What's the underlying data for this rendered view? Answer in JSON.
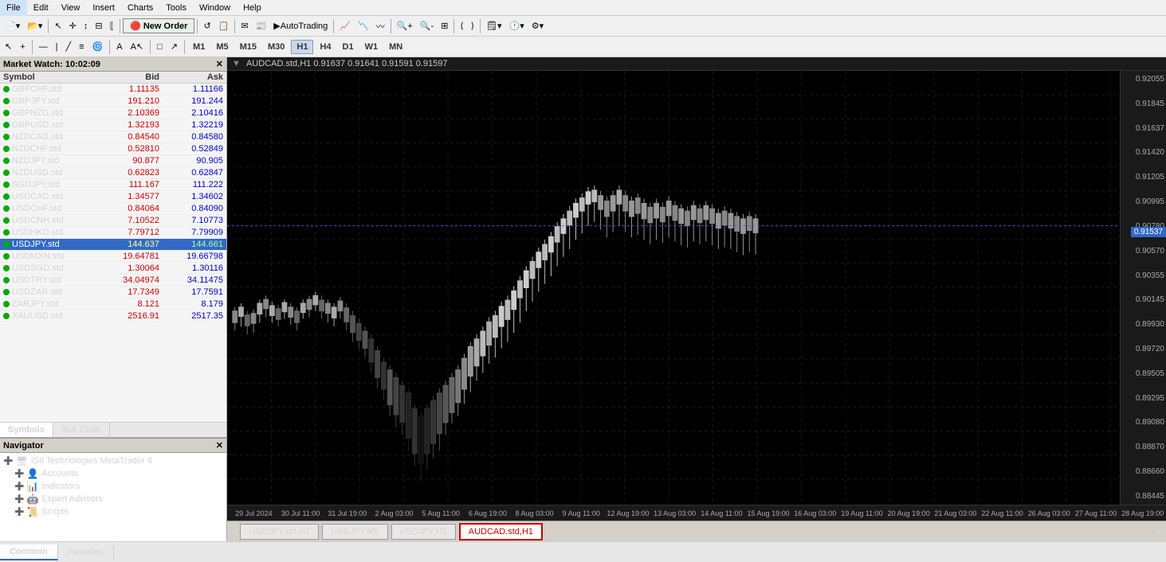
{
  "app": {
    "title": "IS6 Technologies MetaTrader 4"
  },
  "menu": {
    "items": [
      "File",
      "Edit",
      "View",
      "Insert",
      "Charts",
      "Tools",
      "Window",
      "Help"
    ]
  },
  "toolbar1": {
    "new_order_label": "New Order",
    "autotrading_label": "AutoTrading"
  },
  "timeframes": {
    "buttons": [
      "M1",
      "M5",
      "M15",
      "M30",
      "H1",
      "H4",
      "D1",
      "W1",
      "MN"
    ]
  },
  "market_watch": {
    "title": "Market Watch: 10:02:09",
    "columns": [
      "Symbol",
      "Bid",
      "Ask"
    ],
    "symbols": [
      {
        "name": "GBPCHF.std",
        "bid": "1.11135",
        "ask": "1.11166",
        "dot": "green"
      },
      {
        "name": "GBPJPY.std",
        "bid": "191.210",
        "ask": "191.244",
        "dot": "green"
      },
      {
        "name": "GBPNZD.std",
        "bid": "2.10369",
        "ask": "2.10416",
        "dot": "green"
      },
      {
        "name": "GBPUSD.std",
        "bid": "1.32193",
        "ask": "1.32219",
        "dot": "green"
      },
      {
        "name": "NZDCAD.std",
        "bid": "0.84540",
        "ask": "0.84580",
        "dot": "green"
      },
      {
        "name": "NZDCHF.std",
        "bid": "0.52810",
        "ask": "0.52849",
        "dot": "green"
      },
      {
        "name": "NZDJPY.std",
        "bid": "90.877",
        "ask": "90.905",
        "dot": "green"
      },
      {
        "name": "NZDUSD.std",
        "bid": "0.62823",
        "ask": "0.62847",
        "dot": "green"
      },
      {
        "name": "SGDJPY.std",
        "bid": "111.167",
        "ask": "111.222",
        "dot": "green"
      },
      {
        "name": "USDCAD.std",
        "bid": "1.34577",
        "ask": "1.34602",
        "dot": "green"
      },
      {
        "name": "USDCHF.std",
        "bid": "0.84064",
        "ask": "0.84090",
        "dot": "green"
      },
      {
        "name": "USDCNH.std",
        "bid": "7.10522",
        "ask": "7.10773",
        "dot": "green"
      },
      {
        "name": "USDHKD.std",
        "bid": "7.79712",
        "ask": "7.79909",
        "dot": "green"
      },
      {
        "name": "USDJPY.std",
        "bid": "144.637",
        "ask": "144.661",
        "dot": "green",
        "selected": true
      },
      {
        "name": "USDMXN.std",
        "bid": "19.64781",
        "ask": "19.66798",
        "dot": "green"
      },
      {
        "name": "USDSGD.std",
        "bid": "1.30064",
        "ask": "1.30116",
        "dot": "green"
      },
      {
        "name": "USDTRY.std",
        "bid": "34.04974",
        "ask": "34.11475",
        "dot": "green"
      },
      {
        "name": "USDZAR.std",
        "bid": "17.7349",
        "ask": "17.7591",
        "dot": "green"
      },
      {
        "name": "ZARJPY.std",
        "bid": "8.121",
        "ask": "8.179",
        "dot": "green"
      },
      {
        "name": "XAUUSD.std",
        "bid": "2516.91",
        "ask": "2517.35",
        "dot": "green"
      }
    ],
    "tabs": [
      "Symbols",
      "Tick Chart"
    ]
  },
  "navigator": {
    "title": "Navigator",
    "items": [
      {
        "label": "IS6 Technologies MetaTrader 4",
        "icon": "🖥",
        "level": 0
      },
      {
        "label": "Accounts",
        "icon": "👤",
        "level": 1
      },
      {
        "label": "Indicators",
        "icon": "📊",
        "level": 1
      },
      {
        "label": "Expert Advisors",
        "icon": "🤖",
        "level": 1
      },
      {
        "label": "Scripts",
        "icon": "📜",
        "level": 1
      }
    ]
  },
  "chart": {
    "symbol": "AUDCAD.std,H1",
    "header_info": "AUDCAD.std,H1  0.91637 0.91641 0.91591 0.91597",
    "current_price": "0.91537",
    "price_levels": [
      "0.92055",
      "0.91845",
      "0.91637",
      "0.91420",
      "0.91205",
      "0.90995",
      "0.90780",
      "0.90570",
      "0.90355",
      "0.90145",
      "0.89930",
      "0.89720",
      "0.89505",
      "0.89295",
      "0.89080",
      "0.88870",
      "0.88660",
      "0.88445"
    ],
    "time_labels": [
      "29 Jul 2024",
      "30 Jul 11:00",
      "31 Jul 19:00",
      "2 Aug 03:00",
      "5 Aug 11:00",
      "6 Aug 19:00",
      "8 Aug 03:00",
      "9 Aug 11:00",
      "12 Aug 19:00",
      "13 Aug 03:00",
      "14 Aug 11:00",
      "15 Aug 19:00",
      "16 Aug 03:00",
      "19 Aug 11:00",
      "20 Aug 19:00",
      "21 Aug 03:00",
      "22 Aug 11:00",
      "26 Aug 03:00",
      "27 Aug 11:00",
      "28 Aug 19:00"
    ]
  },
  "chart_tabs": [
    {
      "label": "USDJPY.std,H1",
      "active": false
    },
    {
      "label": "USDJPY,M5",
      "active": false
    },
    {
      "label": "USDJPY,H1",
      "active": false
    },
    {
      "label": "AUDCAD.std,H1",
      "active": true
    }
  ],
  "bottom_tabs": [
    {
      "label": "Common",
      "active": true
    },
    {
      "label": "Favorites",
      "active": false
    }
  ]
}
